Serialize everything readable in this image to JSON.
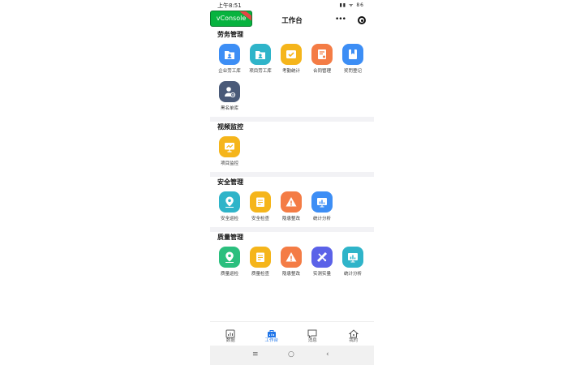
{
  "status": {
    "time": "上午8:51",
    "sys": "▮▮ ᯤ 86"
  },
  "header": {
    "vconsole": "vConsole",
    "title": "工作台",
    "more": "•••"
  },
  "sections": [
    {
      "title": "劳务管理",
      "items": [
        {
          "label": "企业劳工库",
          "color": "#3d8ef5",
          "icon": "folder-user-icon"
        },
        {
          "label": "项目劳工库",
          "color": "#2fb4c9",
          "icon": "folder-user-icon"
        },
        {
          "label": "考勤统计",
          "color": "#f5b51b",
          "icon": "checkmark-box-icon"
        },
        {
          "label": "合同管理",
          "color": "#f47c45",
          "icon": "contract-icon"
        },
        {
          "label": "奖罚登记",
          "color": "#3d8ef5",
          "icon": "bookmark-icon"
        },
        {
          "label": "黑名单库",
          "color": "#4a5a78",
          "icon": "user-blocked-icon"
        }
      ]
    },
    {
      "title": "视频监控",
      "items": [
        {
          "label": "项目监控",
          "color": "#f5b51b",
          "icon": "monitor-chart-icon"
        }
      ]
    },
    {
      "title": "安全管理",
      "items": [
        {
          "label": "安全巡检",
          "color": "#2fb4c9",
          "icon": "location-pin-icon"
        },
        {
          "label": "安全检查",
          "color": "#f5b51b",
          "icon": "clipboard-icon"
        },
        {
          "label": "隐患整改",
          "color": "#f47c45",
          "icon": "warning-icon"
        },
        {
          "label": "统计分析",
          "color": "#3d8ef5",
          "icon": "bar-chart-icon"
        }
      ]
    },
    {
      "title": "质量管理",
      "items": [
        {
          "label": "质量巡检",
          "color": "#2bbf7e",
          "icon": "location-pin-icon"
        },
        {
          "label": "质量检查",
          "color": "#f5b51b",
          "icon": "clipboard-icon"
        },
        {
          "label": "隐患整改",
          "color": "#f47c45",
          "icon": "warning-icon"
        },
        {
          "label": "实测实量",
          "color": "#5b62e8",
          "icon": "ruler-pen-icon"
        },
        {
          "label": "统计分析",
          "color": "#2fb4c9",
          "icon": "bar-chart-icon"
        }
      ]
    }
  ],
  "tabs": [
    {
      "label": "数据",
      "icon": "data-icon",
      "active": false
    },
    {
      "label": "工作台",
      "icon": "workbench-icon",
      "active": true
    },
    {
      "label": "消息",
      "icon": "message-icon",
      "active": false
    },
    {
      "label": "我的",
      "icon": "profile-icon",
      "active": false
    }
  ],
  "nav": {
    "menu": "≡",
    "home": "○",
    "back": "‹"
  }
}
